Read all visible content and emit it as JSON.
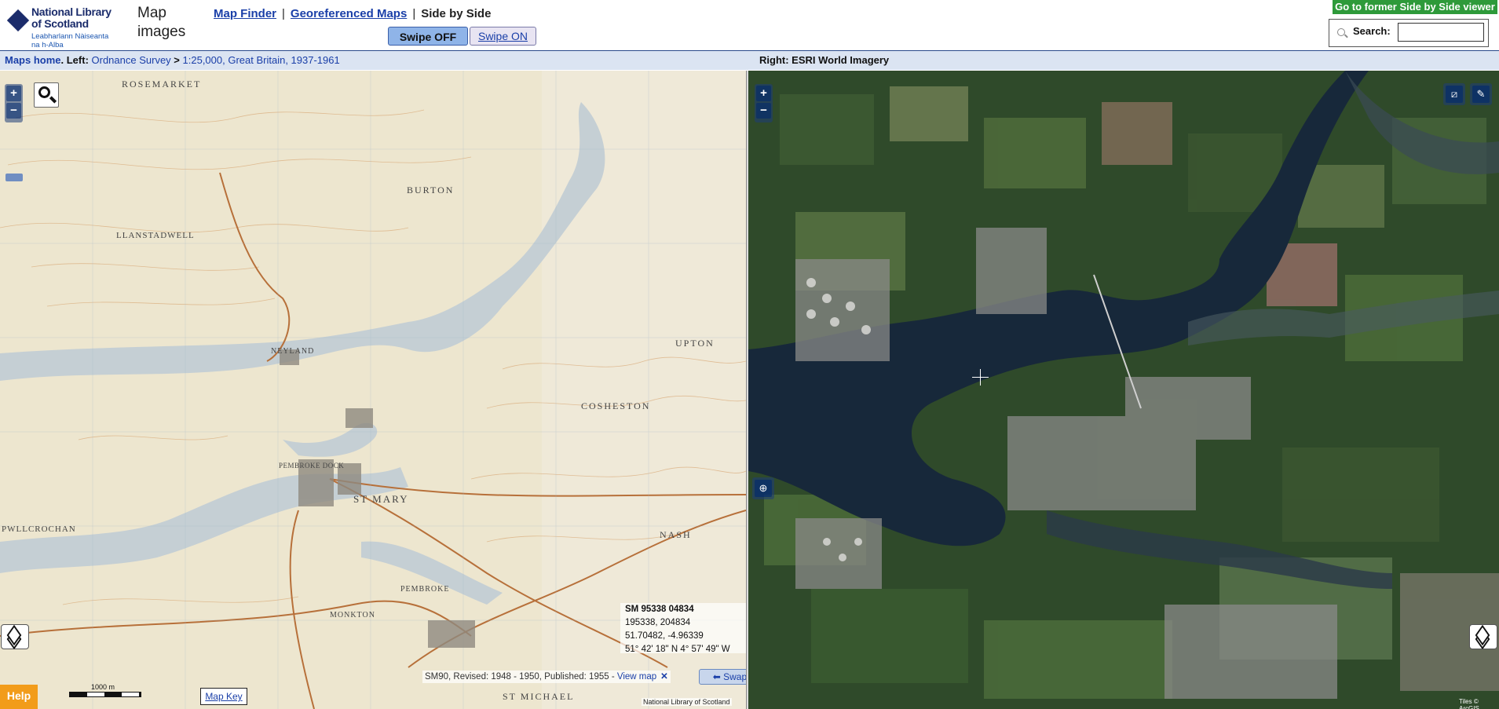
{
  "header": {
    "logo_title": "National Library\nof Scotland",
    "logo_subtitle": "Leabharlann Nàiseanta\nna h-Alba",
    "app_title": "Map\nimages",
    "nav": {
      "map_finder": "Map Finder",
      "georeferenced": "Georeferenced Maps",
      "side_by_side": "Side by Side",
      "separator": "|"
    },
    "swipe_off": "Swipe OFF",
    "swipe_on": "Swipe ON",
    "former_viewer": "Go to former Side by Side viewer",
    "search_label": "Search:",
    "search_value": ""
  },
  "infobar": {
    "maps_home": "Maps home",
    "left_prefix": ". Left: ",
    "ordnance_survey": "Ordnance Survey",
    "arrow": " > ",
    "series": "1:25,000, Great Britain, 1937-1961",
    "right_label": "Right: ESRI World Imagery"
  },
  "left_map": {
    "place_labels": [
      "ROSEMARKET",
      "BURTON",
      "LLANSTADWELL",
      "NEYLAND",
      "UPTON",
      "COSHESTON",
      "PEMBROKE DOCK",
      "ST MARY",
      "NASH",
      "PWLLCROCHAN",
      "PEMBROKE",
      "MONKTON",
      "ST MICHAEL"
    ],
    "coords": {
      "grid_ref": "SM 95338 04834",
      "easting_northing": "195338, 204834",
      "latlon": "51.70482, -4.96339",
      "dms": "51° 42' 18\" N 4° 57' 49\" W"
    },
    "sheet_info": "SM90, Revised: 1948 - 1950, Published: 1955 - ",
    "view_map": "View map",
    "close": "✕",
    "swap_maps": "Swap maps",
    "help": "Help",
    "scale_label": "1000 m",
    "map_key": "Map Key",
    "credit": "National Library of Scotland"
  },
  "right_map": {
    "credit": "Tiles © ArcGIS"
  },
  "controls": {
    "zoom_in": "+",
    "zoom_out": "−"
  },
  "colors": {
    "brand_navy": "#1b2c6b",
    "link": "#1a3fa8",
    "help_orange": "#f29c1a",
    "former_green": "#2e9a3a",
    "infobar_bg": "#dbe4f2"
  }
}
